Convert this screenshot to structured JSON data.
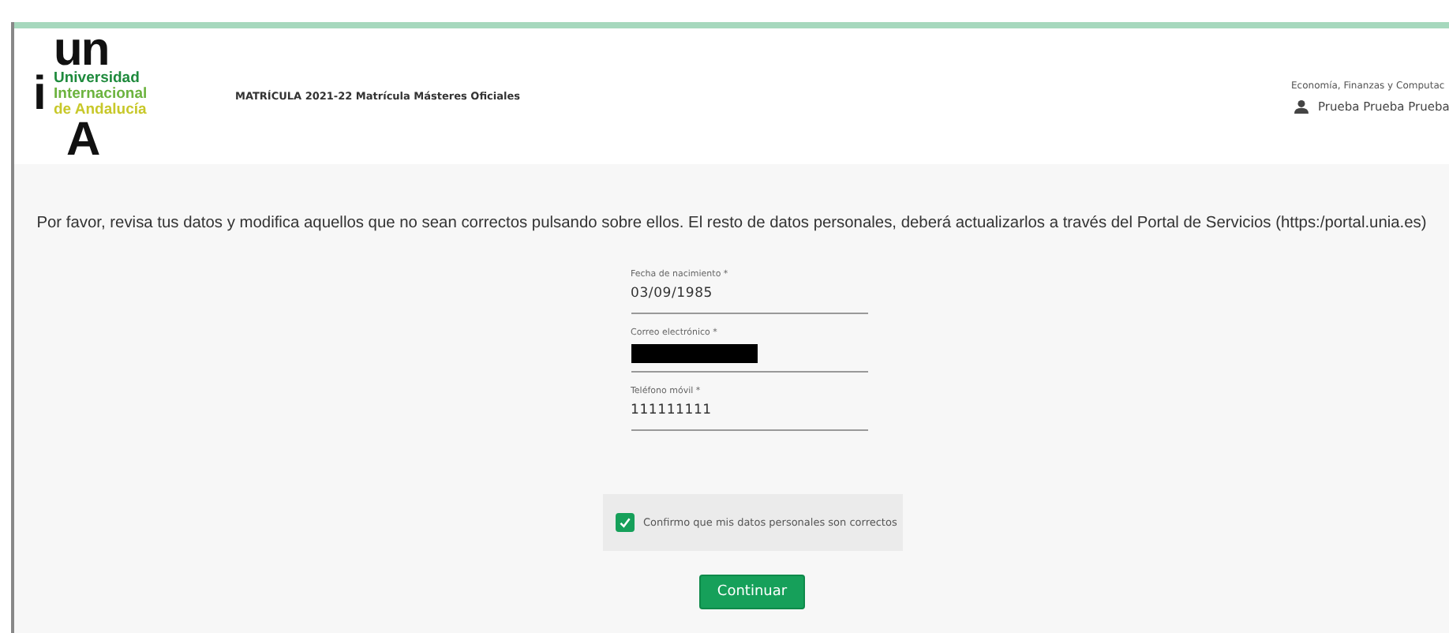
{
  "logo": {
    "top": "un",
    "lines": [
      "Universidad",
      "Internacional",
      "de Andalucía"
    ],
    "side": "i",
    "bottom": "A"
  },
  "header": {
    "title": "MATRÍCULA 2021-22 Matrícula Másteres Oficiales",
    "program": "Economía, Finanzas y Computac",
    "user": "Prueba Prueba Prueba"
  },
  "intro": "Por favor, revisa tus datos y modifica aquellos que no sean correctos pulsando sobre ellos. El resto de datos personales, deberá actualizarlos a través del Portal de Servicios (https:/portal.unia.es)",
  "fields": [
    {
      "kind": "text",
      "label": "Fecha de nacimiento *",
      "value": "03/09/1985"
    },
    {
      "kind": "redacted",
      "label": "Correo electrónico *"
    },
    {
      "kind": "text",
      "label": "Teléfono móvil *",
      "value": "111111111"
    }
  ],
  "confirm": {
    "label": "Confirmo que mis datos personales son correctos",
    "checked": true
  },
  "button": "Continuar"
}
